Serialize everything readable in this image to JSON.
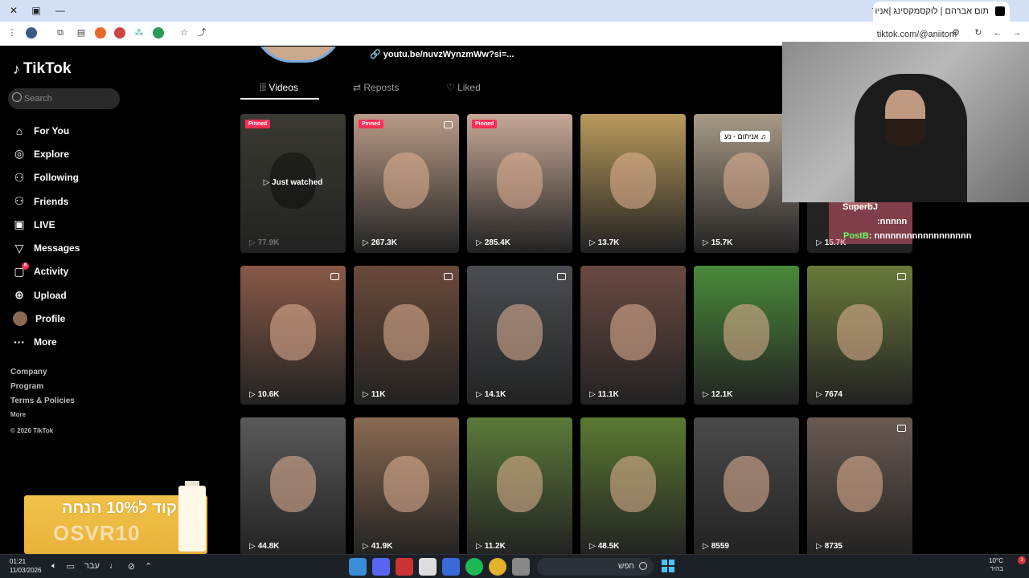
{
  "browser": {
    "tab_title": "תום אברהם | לוקסמקסינג |אניו",
    "url": "tiktok.com/@aniitom",
    "new_tab": "+",
    "tab_close": "✕"
  },
  "sidebar": {
    "logo": "TikTok",
    "search_placeholder": "Search",
    "items": [
      {
        "label": "For You",
        "icon": "home-icon",
        "glyph": "⌂"
      },
      {
        "label": "Explore",
        "icon": "compass-icon",
        "glyph": "◎"
      },
      {
        "label": "Following",
        "icon": "person-icon",
        "glyph": "⚇"
      },
      {
        "label": "Friends",
        "icon": "friends-icon",
        "glyph": "⚇"
      },
      {
        "label": "LIVE",
        "icon": "live-icon",
        "glyph": "▣"
      },
      {
        "label": "Messages",
        "icon": "send-icon",
        "glyph": "▽"
      },
      {
        "label": "Activity",
        "icon": "activity-icon",
        "glyph": "▢",
        "badge": "9"
      },
      {
        "label": "Upload",
        "icon": "upload-icon",
        "glyph": "⊕"
      },
      {
        "label": "Profile",
        "icon": "avatar-icon",
        "glyph": ""
      },
      {
        "label": "More",
        "icon": "more-icon",
        "glyph": "···"
      }
    ],
    "footer": [
      "Company",
      "Program",
      "Terms & Policies"
    ],
    "footer_more": "More",
    "copyright": "© 2026 TikTok"
  },
  "profile": {
    "link": "youtu.be/nuvzWynzmWw?si=...",
    "tabs": [
      {
        "label": "Videos",
        "active": true
      },
      {
        "label": "Reposts",
        "active": false
      },
      {
        "label": "Liked",
        "active": false
      }
    ]
  },
  "videos": [
    {
      "views": "77.9K",
      "pinned": true,
      "just_watched": "Just watched",
      "color": "#3a3a32"
    },
    {
      "views": "267.3K",
      "pinned": true,
      "photo": true,
      "color": "#b89a86"
    },
    {
      "views": "285.4K",
      "pinned": true,
      "color": "#c6a897"
    },
    {
      "views": "13.7K",
      "color": "#b89a5c"
    },
    {
      "views": "15.7K",
      "music": "אניתום - נע ♫",
      "color": "#a89a86"
    },
    {
      "views": "15.7K",
      "color": "#2a2222"
    },
    {
      "views": "10.6K",
      "photo": true,
      "color": "#8a5a48"
    },
    {
      "views": "11K",
      "photo": true,
      "color": "#6a4a3a"
    },
    {
      "views": "14.1K",
      "photo": true,
      "color": "#4a4e52"
    },
    {
      "views": "11.1K",
      "color": "#6a4a42"
    },
    {
      "views": "12.1K",
      "color": "#4a8a3a"
    },
    {
      "views": "7674",
      "photo": true,
      "color": "#6a7a3a"
    },
    {
      "views": "44.8K",
      "color": "#5a5a5a"
    },
    {
      "views": "41.9K",
      "color": "#8a6a52"
    },
    {
      "views": "11.2K",
      "color": "#5a7a3a"
    },
    {
      "views": "48.5K",
      "color": "#5a7a32"
    },
    {
      "views": "8559",
      "color": "#4a4a4a"
    },
    {
      "views": "8735",
      "photo": true,
      "color": "#6a5a52"
    }
  ],
  "stream": {
    "chat": [
      {
        "user": "SuperbJ",
        "text": ""
      },
      {
        "user": "",
        "text": ":nnnnn"
      },
      {
        "user": "PostB",
        "text": ": nnnnnnnnnnnnnnnnnn"
      }
    ],
    "ad_line1": "קוד ל10% הנחה",
    "ad_line2": "OSVR10"
  },
  "taskbar": {
    "time": "01:21",
    "date": "11/03/2026",
    "lang": "עבר",
    "search_label": "חפש",
    "temp": "10°C",
    "weather_text": "בהיר",
    "notif": "3"
  }
}
